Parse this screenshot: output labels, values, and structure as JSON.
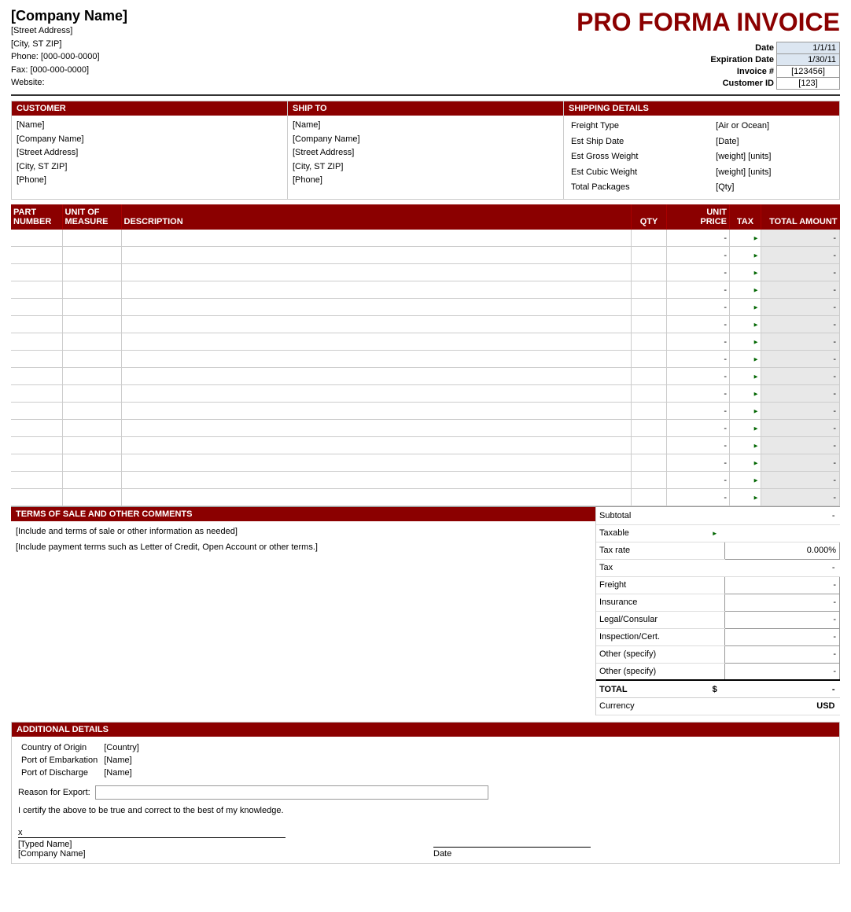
{
  "header": {
    "company_name": "[Company Name]",
    "street_address": "[Street Address]",
    "city_state_zip": "[City, ST  ZIP]",
    "phone": "Phone: [000-000-0000]",
    "fax": "Fax: [000-000-0000]",
    "website": "Website:",
    "invoice_title": "PRO FORMA INVOICE",
    "date_label": "Date",
    "date_value": "1/1/11",
    "expiration_label": "Expiration Date",
    "expiration_value": "1/30/11",
    "invoice_num_label": "Invoice #",
    "invoice_num_value": "[123456]",
    "customer_id_label": "Customer ID",
    "customer_id_value": "[123]"
  },
  "customer": {
    "header": "CUSTOMER",
    "name": "[Name]",
    "company": "[Company Name]",
    "address": "[Street Address]",
    "city": "[City, ST  ZIP]",
    "phone": "[Phone]"
  },
  "ship_to": {
    "header": "SHIP TO",
    "name": "[Name]",
    "company": "[Company Name]",
    "address": "[Street Address]",
    "city": "[City, ST  ZIP]",
    "phone": "[Phone]"
  },
  "shipping_details": {
    "header": "SHIPPING DETAILS",
    "rows": [
      {
        "label": "Freight Type",
        "value": "[Air or Ocean]"
      },
      {
        "label": "Est Ship Date",
        "value": "[Date]"
      },
      {
        "label": "Est Gross Weight",
        "value": "[weight] [units]"
      },
      {
        "label": "Est Cubic Weight",
        "value": "[weight] [units]"
      },
      {
        "label": "Total Packages",
        "value": "[Qty]"
      }
    ]
  },
  "items_table": {
    "columns": [
      {
        "id": "part",
        "line1": "PART",
        "line2": "NUMBER"
      },
      {
        "id": "unit",
        "line1": "UNIT OF",
        "line2": "MEASURE"
      },
      {
        "id": "desc",
        "line1": "DESCRIPTION",
        "line2": ""
      },
      {
        "id": "qty",
        "line1": "QTY",
        "line2": ""
      },
      {
        "id": "price",
        "line1": "UNIT",
        "line2": "PRICE"
      },
      {
        "id": "tax",
        "line1": "TAX",
        "line2": ""
      },
      {
        "id": "total",
        "line1": "TOTAL AMOUNT",
        "line2": ""
      }
    ],
    "row_count": 16,
    "dash": "-"
  },
  "terms": {
    "header": "TERMS OF SALE AND OTHER COMMENTS",
    "line1": "[Include and terms of sale or other information as needed]",
    "line2": "[Include payment terms such as Letter of Credit, Open Account or other terms.]"
  },
  "summary": {
    "rows": [
      {
        "label": "Subtotal",
        "value": "-",
        "type": "plain"
      },
      {
        "label": "Taxable",
        "value": "",
        "type": "arrow"
      },
      {
        "label": "Tax rate",
        "value": "0.000%",
        "type": "bordered"
      },
      {
        "label": "Tax",
        "value": "-",
        "type": "plain"
      },
      {
        "label": "Freight",
        "value": "-",
        "type": "bordered"
      },
      {
        "label": "Insurance",
        "value": "-",
        "type": "bordered"
      },
      {
        "label": "Legal/Consular",
        "value": "-",
        "type": "bordered"
      },
      {
        "label": "Inspection/Cert.",
        "value": "-",
        "type": "bordered"
      },
      {
        "label": "Other (specify)",
        "value": "-",
        "type": "bordered"
      },
      {
        "label": "Other (specify)",
        "value": "-",
        "type": "bordered"
      }
    ],
    "total_label": "TOTAL",
    "total_dollar": "$",
    "total_value": "-",
    "currency_label": "Currency",
    "currency_value": "USD"
  },
  "additional": {
    "header": "ADDITIONAL DETAILS",
    "rows": [
      {
        "label": "Country of Origin",
        "value": "[Country]"
      },
      {
        "label": "Port of Embarkation",
        "value": "[Name]"
      },
      {
        "label": "Port of Discharge",
        "value": "[Name]"
      }
    ],
    "reason_label": "Reason for Export:",
    "certify_text": "I certify the above to be true and correct to the best of my knowledge.",
    "x_label": "x",
    "typed_name": "[Typed Name]",
    "typed_company": "[Company Name]",
    "date_label": "Date"
  }
}
